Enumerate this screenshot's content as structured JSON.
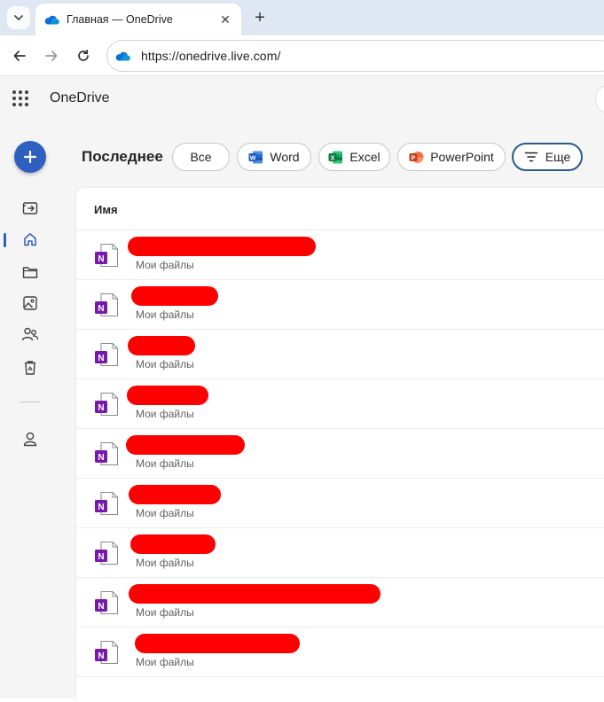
{
  "browser": {
    "tab_title": "Главная — OneDrive",
    "url": "https://onedrive.live.com/"
  },
  "app": {
    "name": "OneDrive"
  },
  "filters": {
    "title": "Последнее",
    "all": "Все",
    "word": "Word",
    "excel": "Excel",
    "powerpoint": "PowerPoint",
    "more": "Еще"
  },
  "list": {
    "column_name": "Имя",
    "rows": [
      {
        "location": "Мои файлы"
      },
      {
        "location": "Мои файлы"
      },
      {
        "location": "Мои файлы"
      },
      {
        "location": "Мои файлы"
      },
      {
        "location": "Мои файлы"
      },
      {
        "location": "Мои файлы"
      },
      {
        "location": "Мои файлы"
      },
      {
        "location": "Мои файлы"
      },
      {
        "location": "Мои файлы"
      }
    ]
  },
  "colors": {
    "accent": "#2f5fbf",
    "onenote": "#7719aa",
    "redaction": "#ff0000"
  },
  "icons": {
    "rail": [
      "shared-icon",
      "home-icon",
      "folder-icon",
      "photos-icon",
      "people-icon",
      "recycle-bin-icon",
      "account-icon"
    ],
    "file": "onenote-icon"
  }
}
